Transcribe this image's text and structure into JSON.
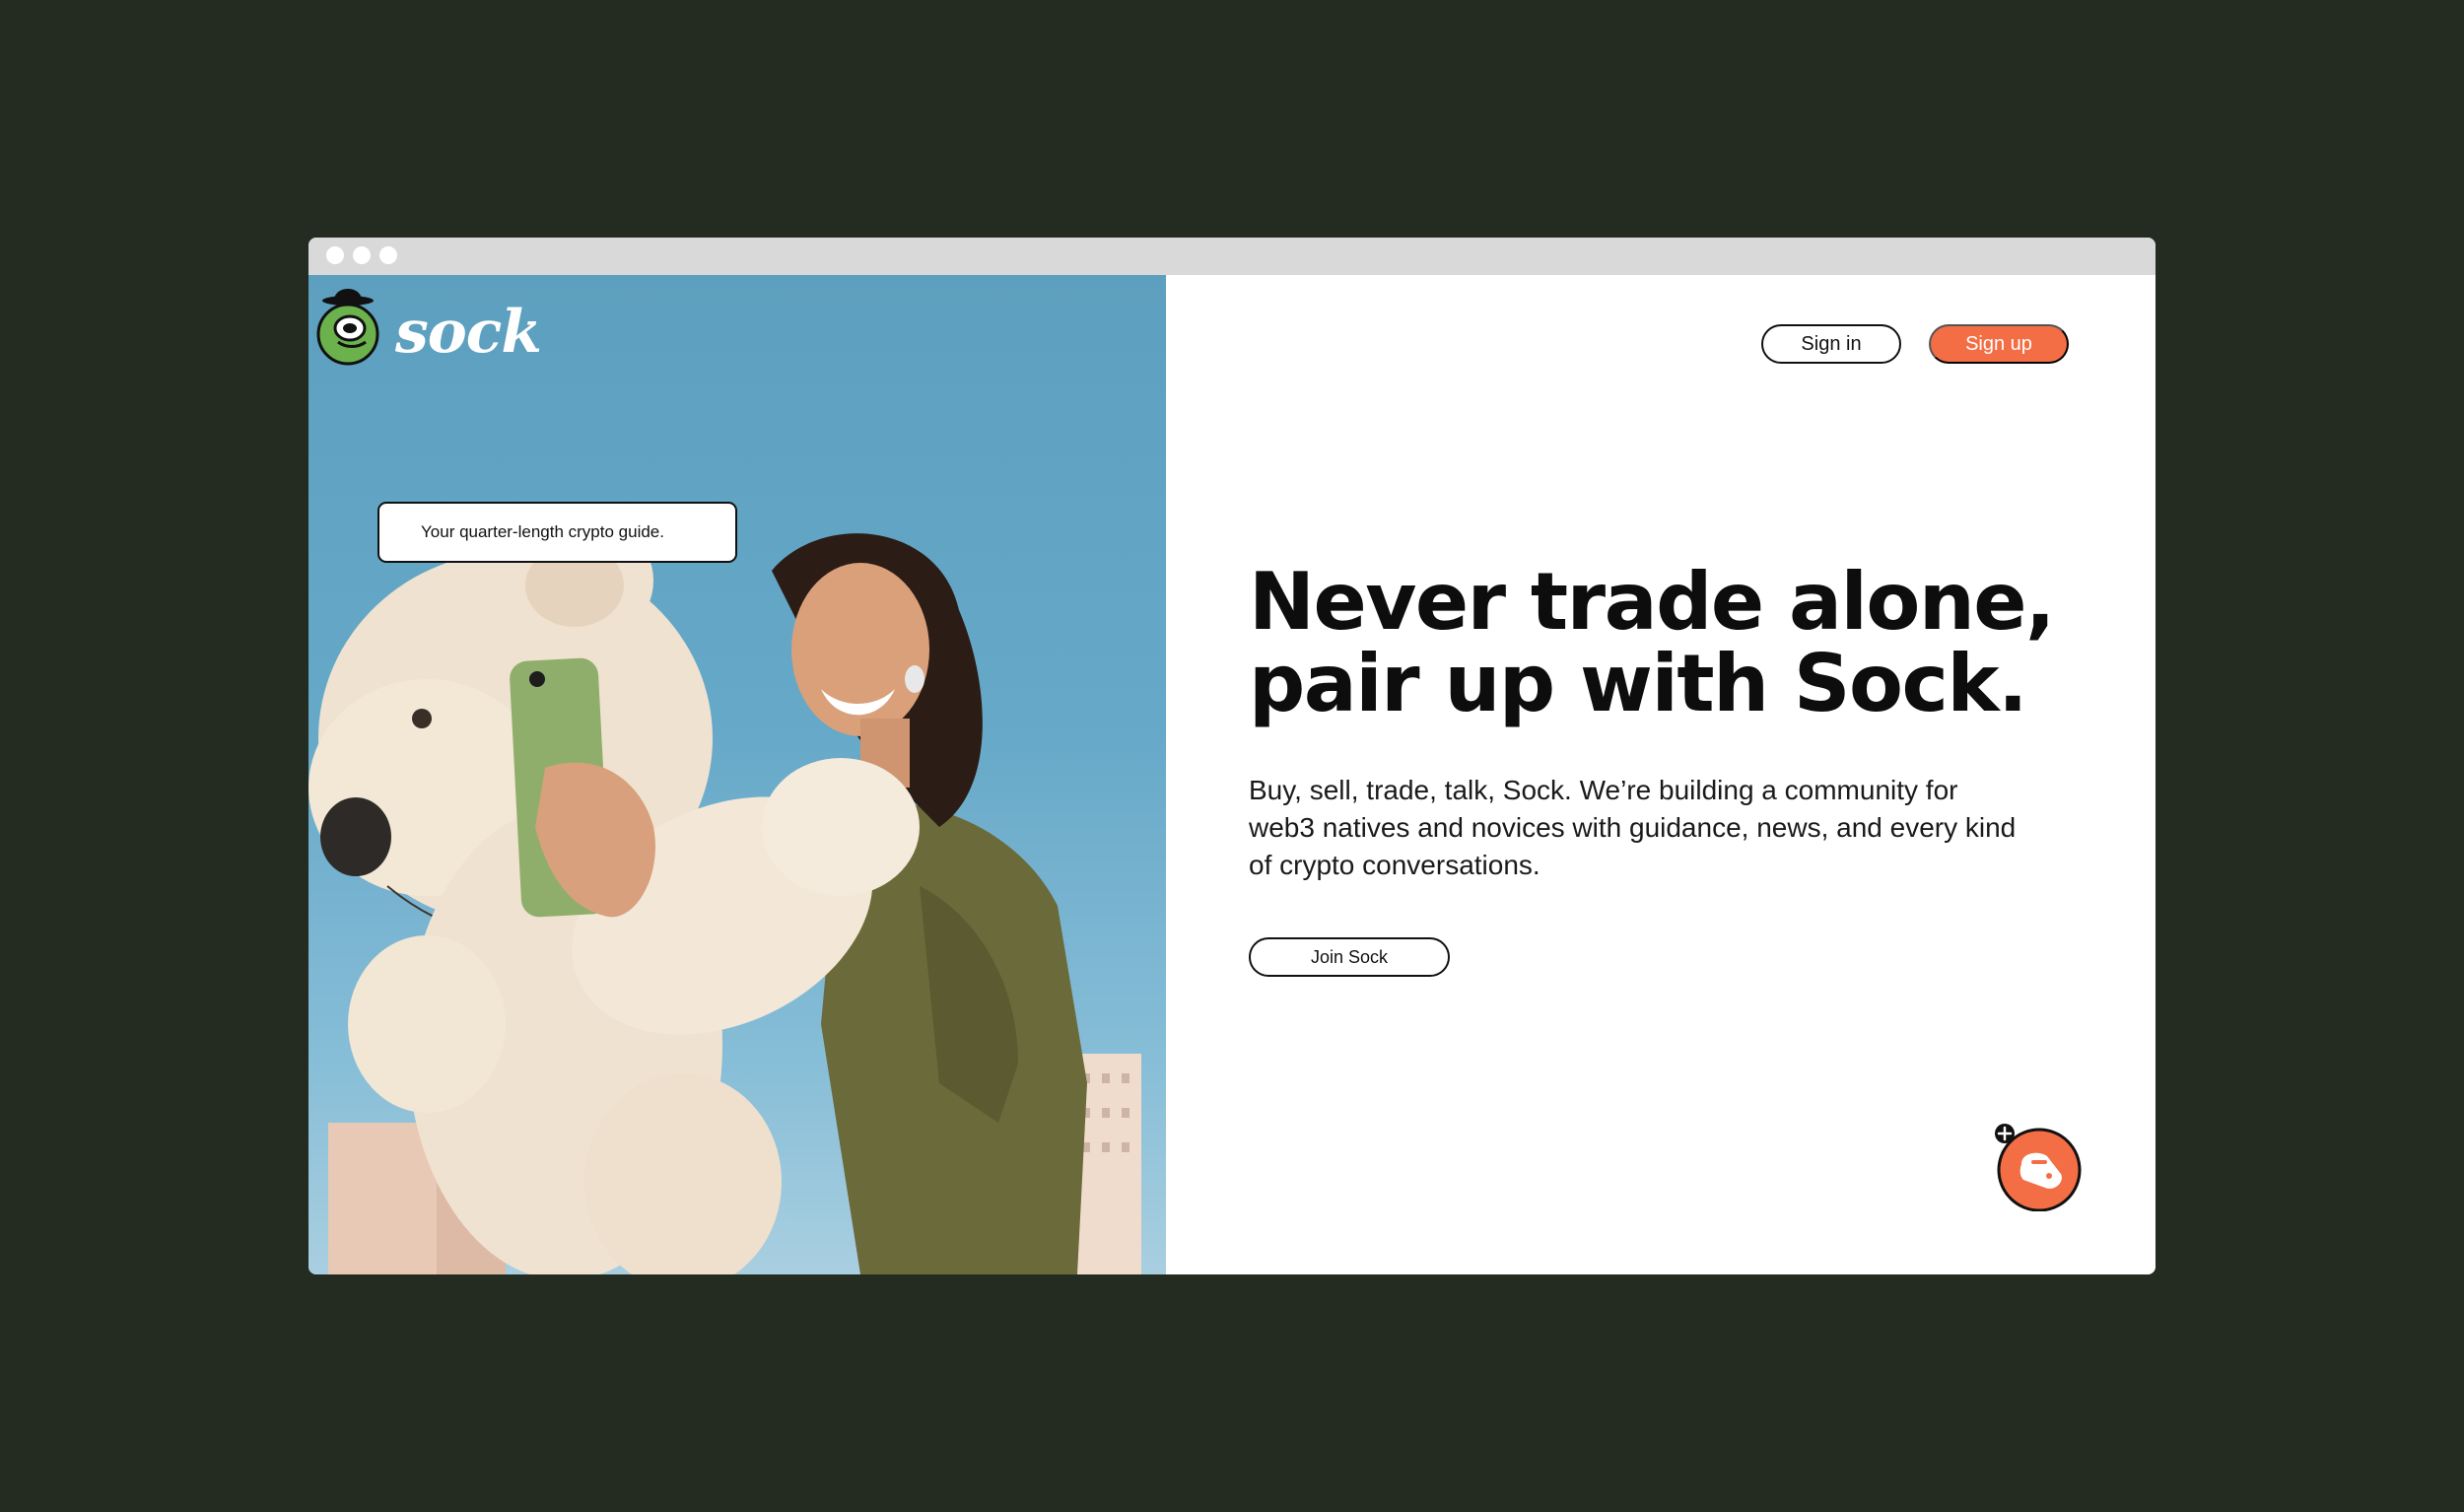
{
  "page": {
    "background": "#242c22"
  },
  "browser": {
    "titlebar_color": "#d9d9d9"
  },
  "hero": {
    "brand": "sock",
    "tooltip": "Your quarter-length crypto guide.",
    "photo_alt_icon": "teddy-bear-photo"
  },
  "nav": {
    "signin_label": "Sign in",
    "signup_label": "Sign up",
    "accent_color": "#f46e45"
  },
  "main": {
    "headline_line1": "Never trade alone,",
    "headline_line2": "pair up with Sock.",
    "description": "Buy, sell, trade, talk, Sock. We’re building a community for web3 natives and novices with guidance, news, and every kind of crypto conversations.",
    "cta_label": "Join Sock"
  },
  "fab": {
    "icon": "sock-face-plus-icon"
  }
}
